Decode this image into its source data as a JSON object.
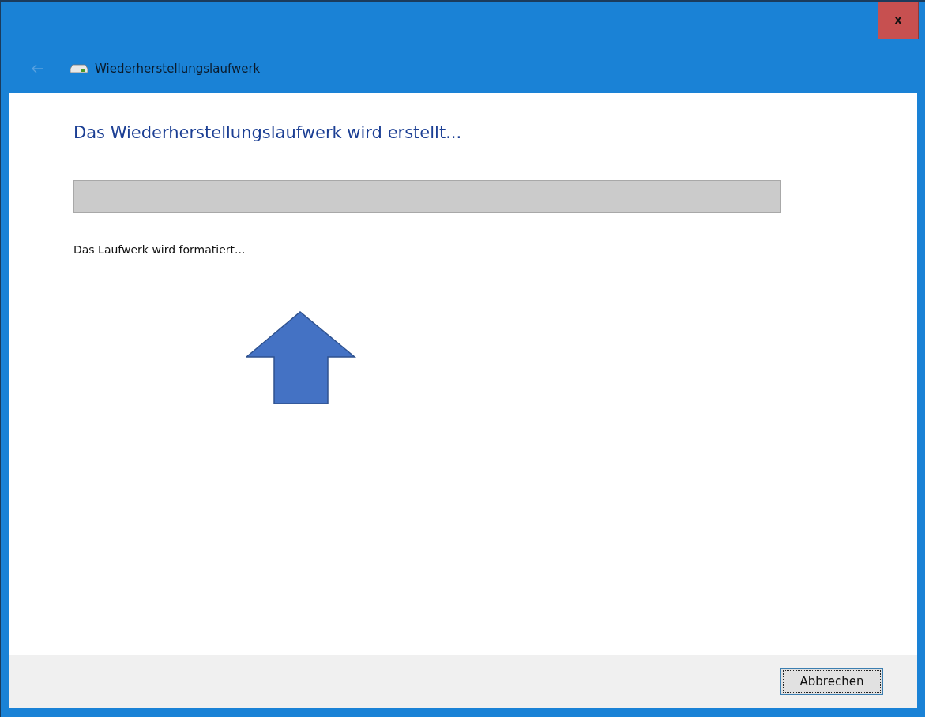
{
  "window": {
    "title": "Wiederherstellungslaufwerk",
    "close": "x"
  },
  "back_button": {
    "disabled": true
  },
  "heading": "Das Wiederherstellungslaufwerk wird erstellt...",
  "progress": {
    "level": 0
  },
  "status": "Das Laufwerk wird formatiert...",
  "annotation": {
    "kind": "arrow-up"
  },
  "buttons": [
    {
      "label": "Abbrechen",
      "focused": true
    }
  ]
}
